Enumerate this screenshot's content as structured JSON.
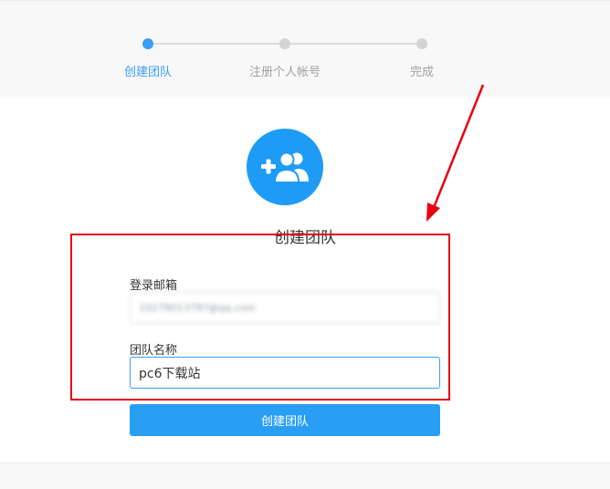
{
  "steps": [
    {
      "label": "创建团队",
      "active": true
    },
    {
      "label": "注册个人帐号",
      "active": false
    },
    {
      "label": "完成",
      "active": false
    }
  ],
  "form": {
    "title": "创建团队",
    "email_label": "登录邮箱",
    "email_value": "1027801378?@qq.com",
    "team_label": "团队名称",
    "team_value": "pc6下载站",
    "submit_label": "创建团队"
  },
  "icons": {
    "team": "add-team-icon"
  },
  "colors": {
    "accent": "#289ef5",
    "annotation": "#e60012"
  }
}
